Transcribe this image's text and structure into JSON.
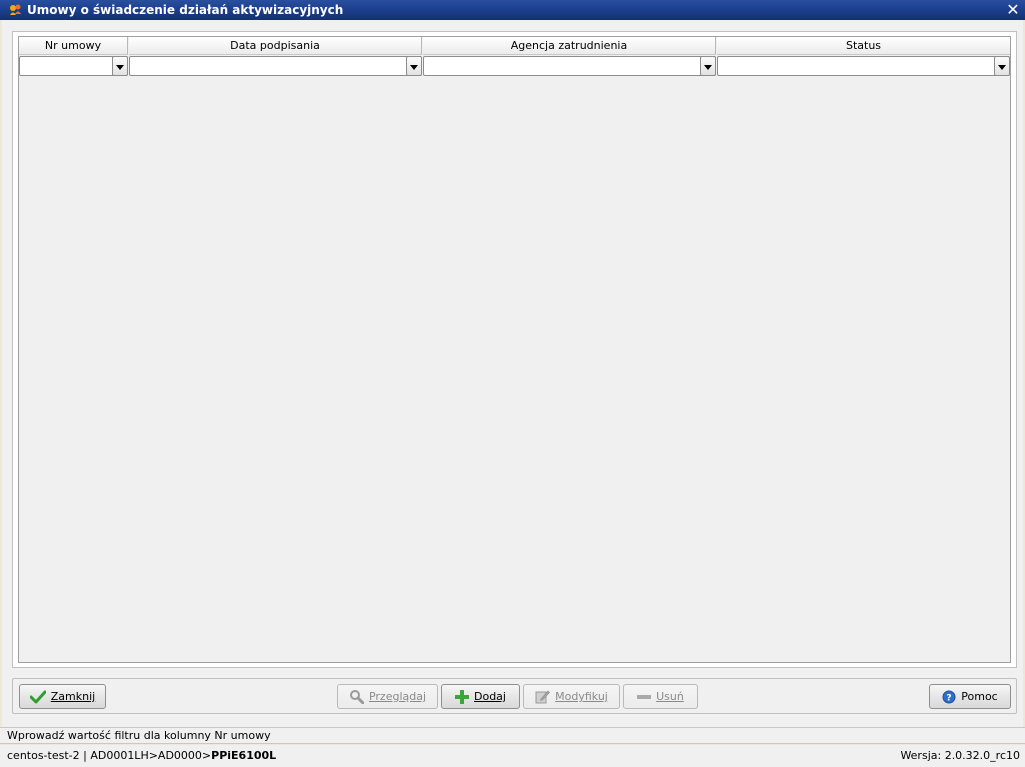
{
  "window": {
    "title": "Umowy o świadczenie działań aktywizacyjnych",
    "close_glyph": "✕"
  },
  "grid": {
    "columns": [
      {
        "label": "Nr umowy",
        "filter_value": ""
      },
      {
        "label": "Data podpisania",
        "filter_value": ""
      },
      {
        "label": "Agencja zatrudnienia",
        "filter_value": ""
      },
      {
        "label": "Status",
        "filter_value": ""
      }
    ],
    "rows": []
  },
  "buttons": {
    "close": {
      "label": "Zamknij",
      "icon": "checkmark-icon",
      "enabled": true
    },
    "browse": {
      "label": "Przeglądaj",
      "icon": "magnifier-icon",
      "enabled": false
    },
    "add": {
      "label": "Dodaj",
      "icon": "plus-icon",
      "enabled": true
    },
    "modify": {
      "label": "Modyfikuj",
      "icon": "edit-icon",
      "enabled": false
    },
    "delete": {
      "label": "Usuń",
      "icon": "minus-icon",
      "enabled": false
    },
    "help": {
      "label": "Pomoc",
      "icon": "help-icon",
      "enabled": true
    }
  },
  "hint": "Wprowadź wartość filtru dla kolumny Nr umowy",
  "statusbar": {
    "path_prefix": "centos-test-2 | AD0001LH>AD0000>",
    "screen_code": "PPiE6100L",
    "version": "Wersja: 2.0.32.0_rc10"
  },
  "colors": {
    "titlebar": "#1b3f8c",
    "check_green": "#2e9e2e",
    "add_green": "#3aa63a",
    "help_blue": "#2f6fc9"
  }
}
